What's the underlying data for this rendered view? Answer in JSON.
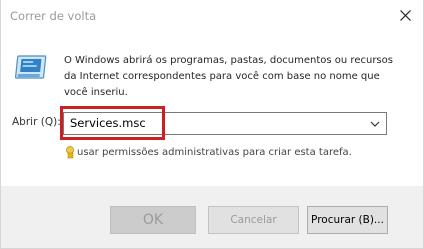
{
  "window": {
    "title": "Correr de volta"
  },
  "icons": {
    "close": "close-icon",
    "run": "run-dialog-icon",
    "admin": "admin-shield-icon",
    "dropdown": "chevron-down-icon"
  },
  "description": "O Windows abrirá os programas, pastas, documentos ou recursos da Internet correspondentes para você com base no nome que você inseriu.",
  "open_field": {
    "label": "Abrir (Q):",
    "value": "Services.msc"
  },
  "admin_note": "usar permissões administrativas para criar esta tarefa.",
  "buttons": {
    "ok": "OK",
    "cancel": "Cancelar",
    "browse": "Procurar (B)..."
  },
  "colors": {
    "highlight": "#cc1f24",
    "footer": "#f0f0f0"
  }
}
